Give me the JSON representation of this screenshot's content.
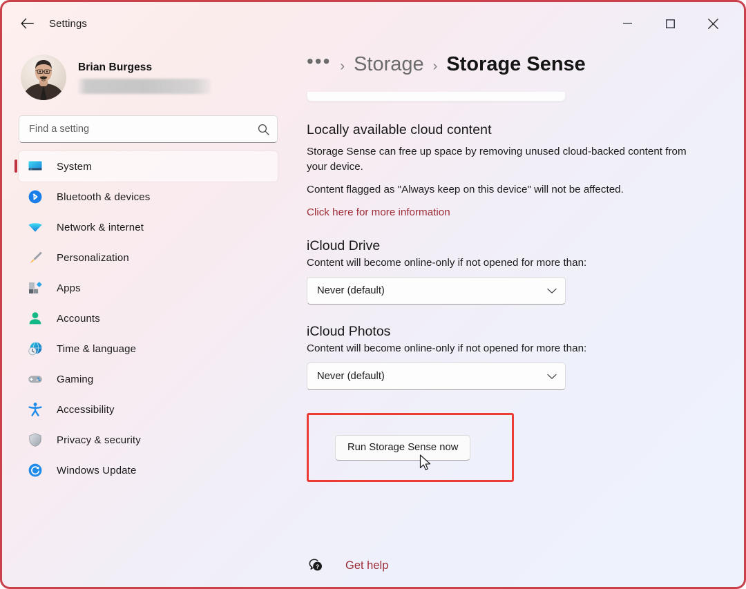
{
  "window": {
    "title": "Settings",
    "back_label": "Back",
    "controls": {
      "minimize": "Minimize",
      "maximize": "Maximize",
      "close": "Close"
    },
    "accent_red": "#c8414b",
    "highlight_red": "#ec3c35",
    "link_color": "#9c2c36"
  },
  "account": {
    "name": "Brian Burgess",
    "email_redacted": ""
  },
  "search": {
    "placeholder": "Find a setting",
    "value": ""
  },
  "sidebar": {
    "items": [
      {
        "label": "System",
        "icon": "monitor-icon",
        "selected": true
      },
      {
        "label": "Bluetooth & devices",
        "icon": "bluetooth-icon",
        "selected": false
      },
      {
        "label": "Network & internet",
        "icon": "wifi-icon",
        "selected": false
      },
      {
        "label": "Personalization",
        "icon": "paintbrush-icon",
        "selected": false
      },
      {
        "label": "Apps",
        "icon": "apps-icon",
        "selected": false
      },
      {
        "label": "Accounts",
        "icon": "person-icon",
        "selected": false
      },
      {
        "label": "Time & language",
        "icon": "clock-globe-icon",
        "selected": false
      },
      {
        "label": "Gaming",
        "icon": "gamepad-icon",
        "selected": false
      },
      {
        "label": "Accessibility",
        "icon": "accessibility-icon",
        "selected": false
      },
      {
        "label": "Privacy & security",
        "icon": "shield-icon",
        "selected": false
      },
      {
        "label": "Windows Update",
        "icon": "refresh-icon",
        "selected": false
      }
    ]
  },
  "breadcrumb": {
    "ellipsis": "•••",
    "separator": "›",
    "parent": "Storage",
    "current": "Storage Sense"
  },
  "main": {
    "cloud_section": {
      "title": "Locally available cloud content",
      "description_1": "Storage Sense can free up space by removing unused cloud-backed content from your device.",
      "description_2": "Content flagged as \"Always keep on this device\" will not be affected.",
      "link": "Click here for more information"
    },
    "icloud_drive": {
      "title": "iCloud Drive",
      "description": "Content will become online-only if not opened for more than:",
      "dropdown_value": "Never (default)"
    },
    "icloud_photos": {
      "title": "iCloud Photos",
      "description": "Content will become online-only if not opened for more than:",
      "dropdown_value": "Never (default)"
    },
    "run_button": "Run Storage Sense now"
  },
  "footer": {
    "help_label": "Get help"
  }
}
